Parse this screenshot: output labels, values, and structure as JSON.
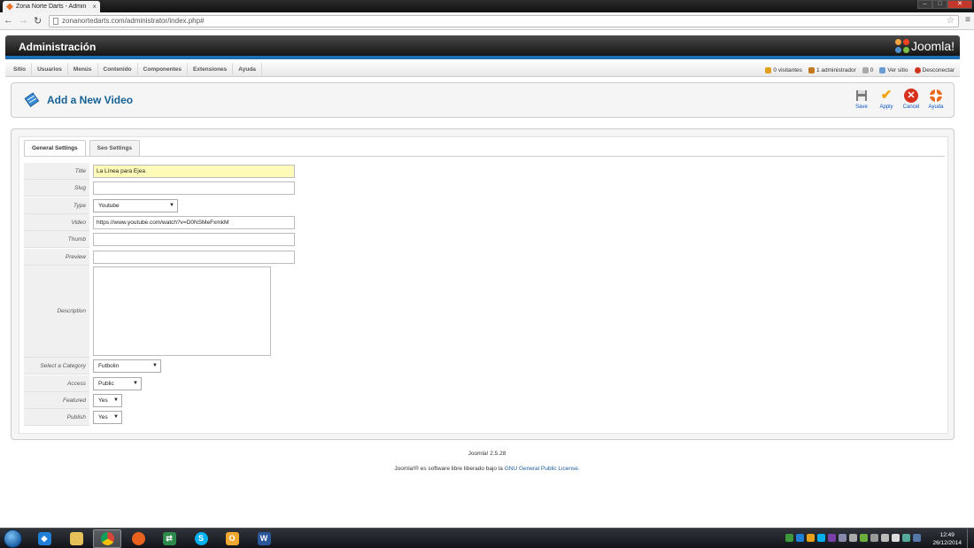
{
  "browser": {
    "tab_title": "Zona Norte Darts - Admin",
    "tab_close": "×",
    "url": "zonanortedarts.com/administrator/index.php#"
  },
  "header": {
    "admin_title": "Administración",
    "logo_text": "Joomla!"
  },
  "menu": {
    "items": [
      "Sitio",
      "Usuarios",
      "Menús",
      "Contenido",
      "Componentes",
      "Extensiones",
      "Ayuda"
    ],
    "status": {
      "visitors": "0 visitantes",
      "admins": "1 administrador",
      "messages": "0",
      "view_site": "Ver sitio",
      "logout": "Desconectar"
    }
  },
  "page": {
    "title": "Add a New Video",
    "buttons": {
      "save": "Save",
      "apply": "Apply",
      "cancel": "Cancel",
      "help": "Ayuda"
    }
  },
  "tabs": [
    "General Settings",
    "Seo Settings"
  ],
  "form": {
    "title_label": "Title",
    "title_value": "La Línea para Ejea",
    "slug_label": "Slug",
    "slug_value": "",
    "type_label": "Type",
    "type_value": "Youtube",
    "video_label": "Video",
    "video_value": "https://www.youtube.com/watch?v=D0NSMeFxmkM",
    "thumb_label": "Thumb",
    "thumb_value": "",
    "preview_label": "Preview",
    "preview_value": "",
    "description_label": "Description",
    "category_label": "Select a Category",
    "category_value": "Futbolin",
    "access_label": "Access",
    "access_value": "Public",
    "featured_label": "Featured",
    "featured_value": "Yes",
    "publish_label": "Publish",
    "publish_value": "Yes"
  },
  "footer": {
    "version": "Joomla! 2.5.28",
    "license_prefix": "Joomla!® es software libre liberado bajo la",
    "license_link": "GNU General Public License."
  },
  "taskbar": {
    "time": "12:49",
    "date": "26/12/2014"
  },
  "colors": {
    "joomla_blue": "#1c6fb4",
    "title_blue": "#146295",
    "highlight_field": "#fdfbb7"
  }
}
